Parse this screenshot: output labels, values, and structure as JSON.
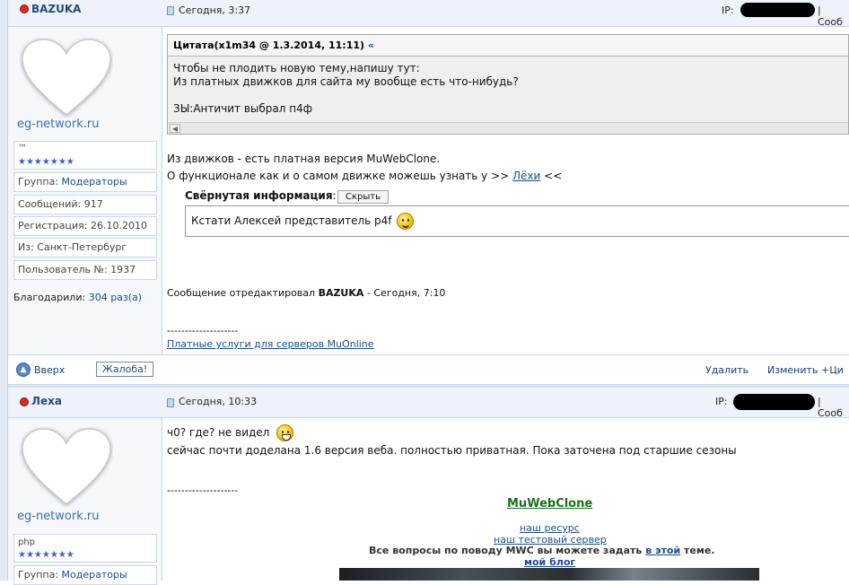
{
  "posts": [
    {
      "author": "BAZUKA",
      "date": "Сегодня, 3:37",
      "ip_label": "IP:",
      "ip_suffix": "| Сооб",
      "avatar_site": "eg-network.ru",
      "title": "™",
      "info": {
        "group_label": "Группа:",
        "group_value": "Модераторы",
        "posts_label": "Сообщений: 917",
        "reg_label": "Регистрация: 26.10.2010",
        "from_label": "Из: Санкт-Петербург",
        "user_no_label": "Пользователь №: 1937",
        "thanks_label": "Благодарили:",
        "thanks_value": "304 раз(а)"
      },
      "quote": {
        "header": "Цитата(x1m34 @ 1.3.2014, 11:11)",
        "back_link": "«",
        "lines": [
          "Чтобы не плодить новую тему,напишу тут:",
          "Из платных движков для сайта му вообще есть что-нибудь?",
          "",
          "ЗЫ:Античит выбрал п4ф"
        ]
      },
      "body": {
        "line1": "Из движков - есть платная версия MuWebClone.",
        "line2_prefix": "О функционале как и о самом движке можешь узнать у >> ",
        "line2_link": "Лёхи",
        "line2_suffix": " <<"
      },
      "spoiler": {
        "label": "Свёрнутая информация",
        "colon": ":",
        "button": "Скрыть",
        "content": "Кстати Алексей представитель p4f"
      },
      "edited": {
        "prefix": "Сообщение отредактировал ",
        "who": "BAZUKA",
        "suffix": " - Сегодня, 7:10"
      },
      "signature": {
        "dashes": "--------------------",
        "link": "Платные услуги для серверов MuOnline"
      },
      "footer": {
        "up": "Вверх",
        "report": "Жалоба!",
        "delete": "Удалить",
        "edit": "Изменить",
        "quote": "+Ци"
      }
    },
    {
      "author": "Леха",
      "date": "Сегодня, 10:33",
      "ip_label": "IP:",
      "ip_suffix": "| Сооб",
      "avatar_site": "eg-network.ru",
      "title": "php",
      "info": {
        "group_label": "Группа:",
        "group_value": "Модераторы"
      },
      "body": {
        "line1": "ч0? где? не видел",
        "line2": "сейчас почти доделана 1.6 версия веба. полностью приватная. Пока заточена под старшие сезоны"
      },
      "signature": {
        "dashes": "--------------------",
        "title": "MuWebClone",
        "link1": "наш ресурс",
        "link2": "наш тестовый сервер",
        "question_prefix": "Все вопросы по поводу MWC вы можете задать ",
        "question_link": "в этой",
        "question_suffix": " теме.",
        "blog": "мой блог"
      }
    }
  ],
  "colors": {
    "accent": "#1a4c8c",
    "header_bg": "#eef3f9",
    "sidebar_bg": "#f5f7fb",
    "status_dot": "#d92a22"
  }
}
